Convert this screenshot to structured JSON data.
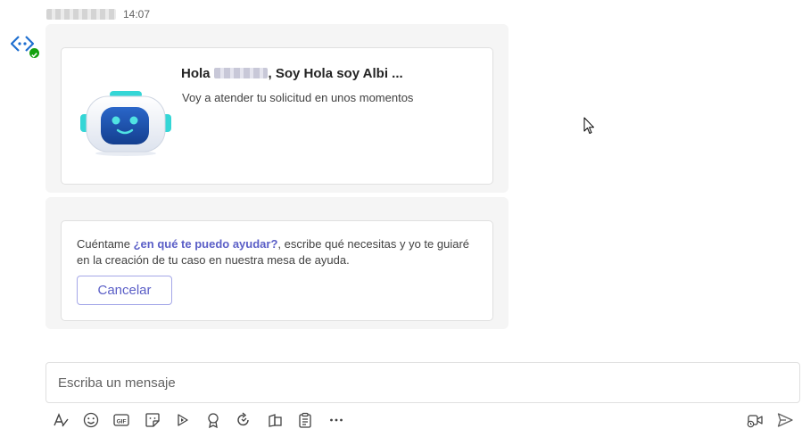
{
  "message": {
    "sender_name": "",
    "timestamp": "14:07"
  },
  "card1": {
    "greeting_prefix": "Hola",
    "greeting_suffix": ", Soy Hola soy Albi ...",
    "subtitle": "Voy a atender tu solicitud en unos momentos"
  },
  "card2": {
    "text_start": "Cuéntame ",
    "text_highlight": "¿en qué te puedo ayudar?",
    "text_end": ", escribe qué necesitas y yo te guiaré en la creación de tu caso en nuestra mesa de ayuda.",
    "cancel_label": "Cancelar"
  },
  "compose": {
    "placeholder": "Escriba un mensaje",
    "value": ""
  },
  "toolbar": {
    "icons": [
      "format-icon",
      "emoji-icon",
      "gif-icon",
      "sticker-icon",
      "loop-icon",
      "praise-icon",
      "refresh-icon",
      "apps-icon",
      "forms-icon",
      "more-icon"
    ],
    "meet_icon": "meet-now-icon",
    "send_icon": "send-icon"
  },
  "colors": {
    "accent": "#5b5fc7",
    "presence": "#13a10e",
    "bubble_bg": "#f5f5f5"
  }
}
